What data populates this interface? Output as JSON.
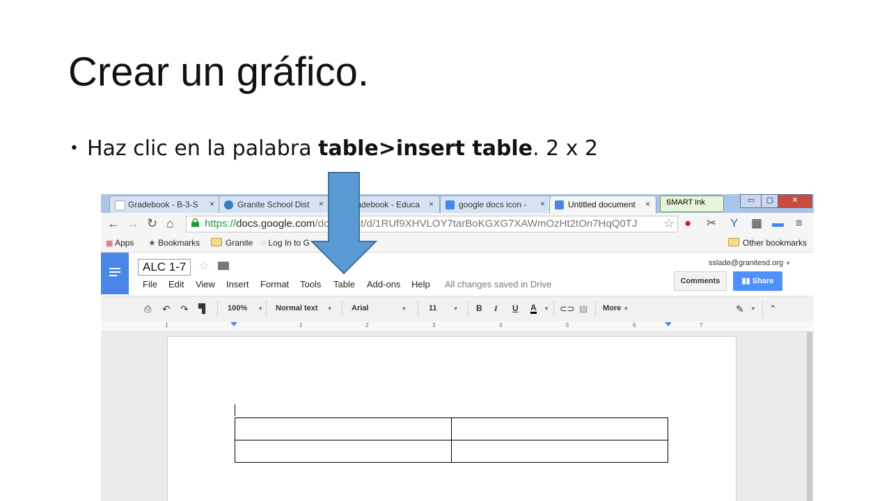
{
  "slide": {
    "title": "Crear un gráfico.",
    "bullet_prefix": "Haz clic en la palabra ",
    "bullet_bold": "table>insert table",
    "bullet_suffix": ".  2 x 2"
  },
  "browser": {
    "tabs": [
      {
        "label": "Gradebook - B-3-S",
        "icon": "doc-icon",
        "color": "#9aa7b6"
      },
      {
        "label": "Granite School Dist",
        "icon": "granite-icon",
        "color": "#3a7bbf"
      },
      {
        "label": "Gradebook - Educa",
        "icon": "doc-icon",
        "color": "#9aa7b6"
      },
      {
        "label": "google docs icon -",
        "icon": "google-icon",
        "color": "#4285f4"
      },
      {
        "label": "Untitled document",
        "icon": "docs-icon",
        "color": "#4a86e8",
        "active": true
      }
    ],
    "close_glyph": "×",
    "smart_ink": "SMART Ink",
    "window_buttons": {
      "minimize": "▭",
      "maximize": "▢",
      "close": "✕"
    },
    "url_proto": "https://",
    "url_host": "docs.google.com",
    "url_path": "/document/d/1RUf9XHVLOY7tarBoKGXG7XAWmOzHt2tOn7HqQ0TJ",
    "bookmarks": [
      {
        "label": "Apps",
        "icon": "apps-grid-icon"
      },
      {
        "label": "Bookmarks",
        "icon": "star-icon"
      },
      {
        "label": "Granite",
        "icon": "folder-icon"
      },
      {
        "label": "Log In to G",
        "icon": "login-icon"
      }
    ],
    "other_bookmarks": "Other bookmarks"
  },
  "docs": {
    "title": "ALC 1-7",
    "menu": [
      "File",
      "Edit",
      "View",
      "Insert",
      "Format",
      "Tools",
      "Table",
      "Add-ons",
      "Help"
    ],
    "save_status": "All changes saved in Drive",
    "email": "sslade@granitesd.org",
    "comments_label": "Comments",
    "share_label": "Share",
    "toolbar": {
      "zoom": "100%",
      "style": "Normal text",
      "font": "Arial",
      "size": "11",
      "bold": "B",
      "italic": "I",
      "underline": "U",
      "text_color": "A",
      "more": "More"
    },
    "ruler_numbers": [
      "1",
      "1",
      "2",
      "3",
      "4",
      "5",
      "6",
      "7"
    ],
    "table": {
      "rows": 2,
      "cols": 2
    }
  },
  "colors": {
    "docs_blue": "#4a86e8",
    "share_blue": "#4d90fe",
    "arrow_blue": "#5b9bd5",
    "arrow_outline": "#41719c"
  }
}
